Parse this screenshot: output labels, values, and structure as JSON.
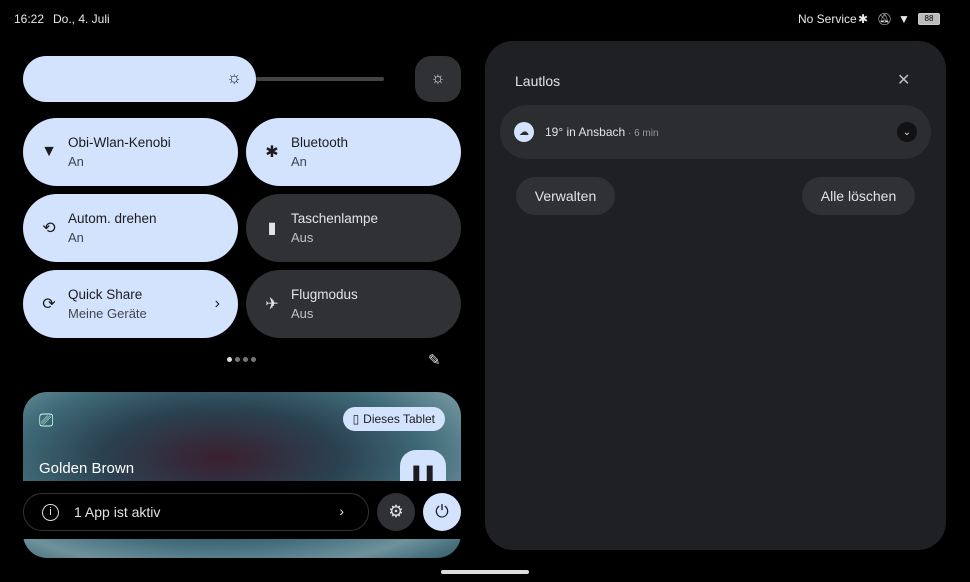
{
  "status": {
    "time": "16:22",
    "date": "Do., 4. Juli",
    "carrier": "No Service",
    "battery": "88"
  },
  "tiles": [
    {
      "title": "Obi-Wlan-Kenobi",
      "sub": "An",
      "icon": "wifi-icon",
      "on": true
    },
    {
      "title": "Bluetooth",
      "sub": "An",
      "icon": "bluetooth-icon",
      "on": true
    },
    {
      "title": "Autom. drehen",
      "sub": "An",
      "icon": "rotate-icon",
      "on": true
    },
    {
      "title": "Taschenlampe",
      "sub": "Aus",
      "icon": "flashlight-icon",
      "on": false
    },
    {
      "title": "Quick Share",
      "sub": "Meine Geräte",
      "icon": "quick-share-icon",
      "on": true
    },
    {
      "title": "Flugmodus",
      "sub": "Aus",
      "icon": "airplane-icon",
      "on": false
    }
  ],
  "brightness": 0.6,
  "media": {
    "title": "Golden Brown",
    "device": "Dieses Tablet"
  },
  "footer": {
    "active_apps": "1 App ist aktiv"
  },
  "notifications": {
    "header": "Lautlos",
    "items": [
      {
        "title": "19° in Ansbach",
        "time": "6 min"
      }
    ],
    "manage": "Verwalten",
    "clear_all": "Alle löschen"
  }
}
